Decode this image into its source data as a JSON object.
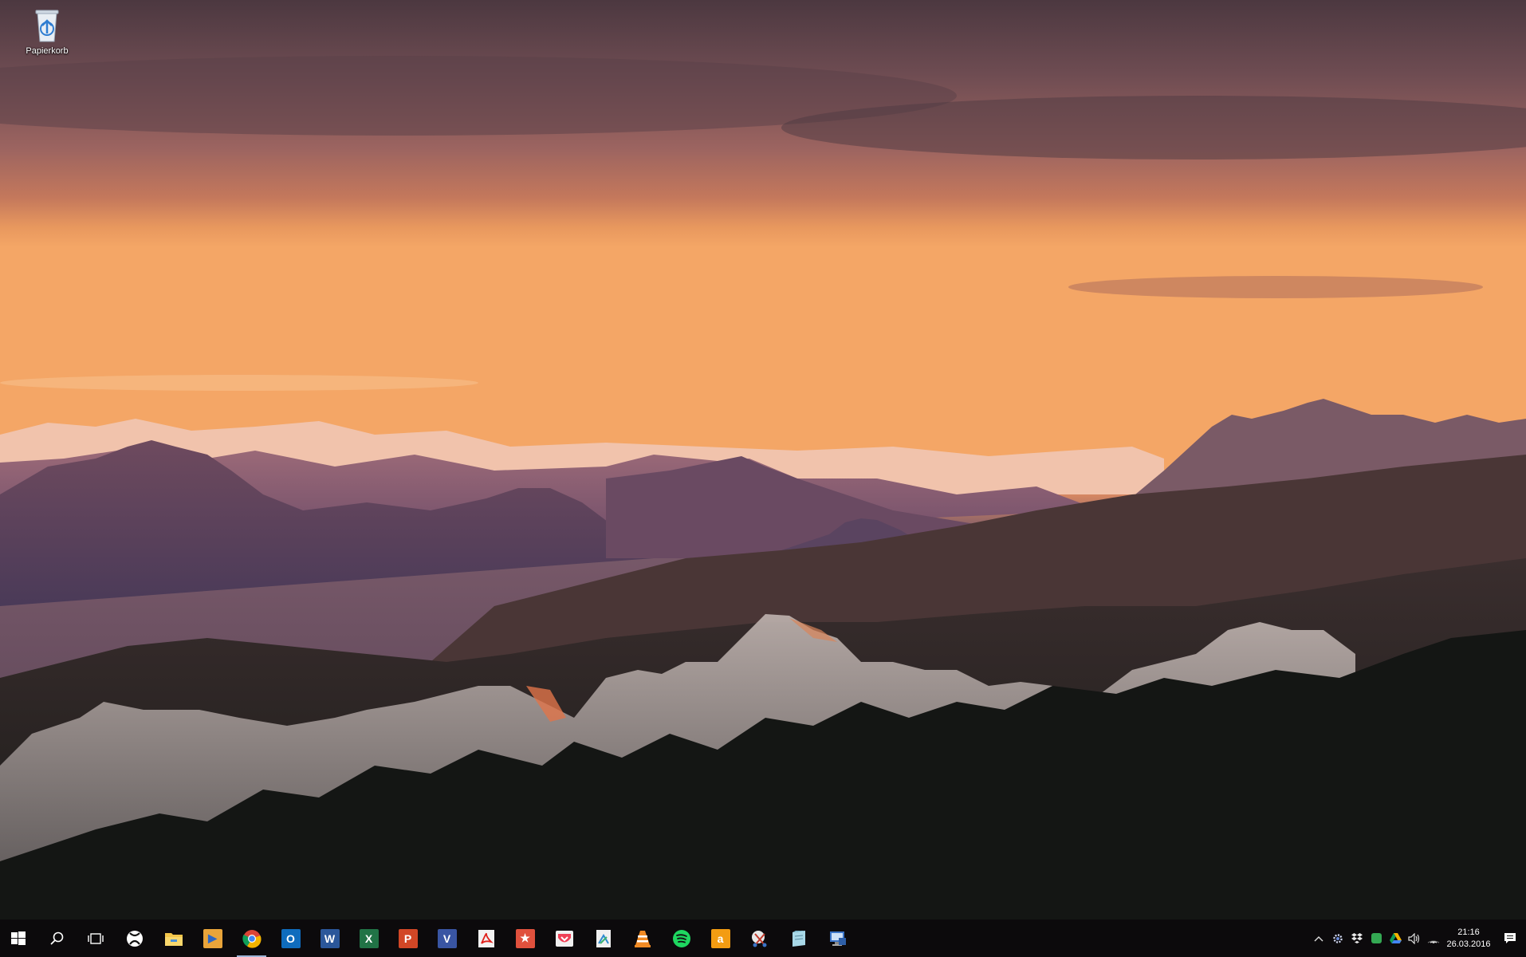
{
  "desktop": {
    "icons": [
      {
        "label": "Papierkorb",
        "icon": "recycle-bin-icon"
      }
    ]
  },
  "taskbar": {
    "start": {
      "icon": "windows-start-icon"
    },
    "search": {
      "icon": "search-icon"
    },
    "task_view": {
      "icon": "task-view-icon"
    },
    "apps": [
      {
        "name": "xbox",
        "icon": "xbox-icon",
        "color": "#ffffff",
        "glyph": ""
      },
      {
        "name": "file-explorer",
        "icon": "folder-icon",
        "color": "#f3c54a",
        "glyph": ""
      },
      {
        "name": "media-player",
        "icon": "media-player-icon",
        "color": "#e9a43a",
        "glyph": "▶"
      },
      {
        "name": "chrome",
        "icon": "chrome-icon",
        "color": "#4285f4",
        "glyph": ""
      },
      {
        "name": "outlook",
        "icon": "outlook-icon",
        "color": "#0f6cbd",
        "glyph": "O"
      },
      {
        "name": "word",
        "icon": "word-icon",
        "color": "#2b579a",
        "glyph": "W"
      },
      {
        "name": "excel",
        "icon": "excel-icon",
        "color": "#217346",
        "glyph": "X"
      },
      {
        "name": "powerpoint",
        "icon": "powerpoint-icon",
        "color": "#d24726",
        "glyph": "P"
      },
      {
        "name": "visio",
        "icon": "visio-icon",
        "color": "#3955a3",
        "glyph": "V"
      },
      {
        "name": "acrobat",
        "icon": "pdf-icon",
        "color": "#e8e8e8",
        "glyph": ""
      },
      {
        "name": "wunderlist",
        "icon": "wunderlist-icon",
        "color": "#e0513d",
        "glyph": "★"
      },
      {
        "name": "pocket",
        "icon": "pocket-icon",
        "color": "#ef4056",
        "glyph": ""
      },
      {
        "name": "sheets",
        "icon": "document-icon",
        "color": "#f0f0f0",
        "glyph": ""
      },
      {
        "name": "vlc",
        "icon": "vlc-icon",
        "color": "#f08a24",
        "glyph": ""
      },
      {
        "name": "spotify",
        "icon": "spotify-icon",
        "color": "#1ed760",
        "glyph": ""
      },
      {
        "name": "amazon",
        "icon": "amazon-icon",
        "color": "#f39c12",
        "glyph": "a"
      },
      {
        "name": "snipping-tool",
        "icon": "snipping-tool-icon",
        "color": "#d0d0d0",
        "glyph": ""
      },
      {
        "name": "notepad",
        "icon": "notepad-icon",
        "color": "#a8d8e8",
        "glyph": ""
      },
      {
        "name": "remote-desktop",
        "icon": "remote-desktop-icon",
        "color": "#3b74c8",
        "glyph": ""
      }
    ]
  },
  "tray": {
    "icons": [
      "chevron-up-icon",
      "gear-tray-icon",
      "dropbox-icon",
      "sync-icon",
      "google-drive-icon",
      "volume-icon",
      "wifi-icon"
    ],
    "time": "21:16",
    "date": "26.03.2016",
    "notification_icon": "action-center-icon"
  }
}
